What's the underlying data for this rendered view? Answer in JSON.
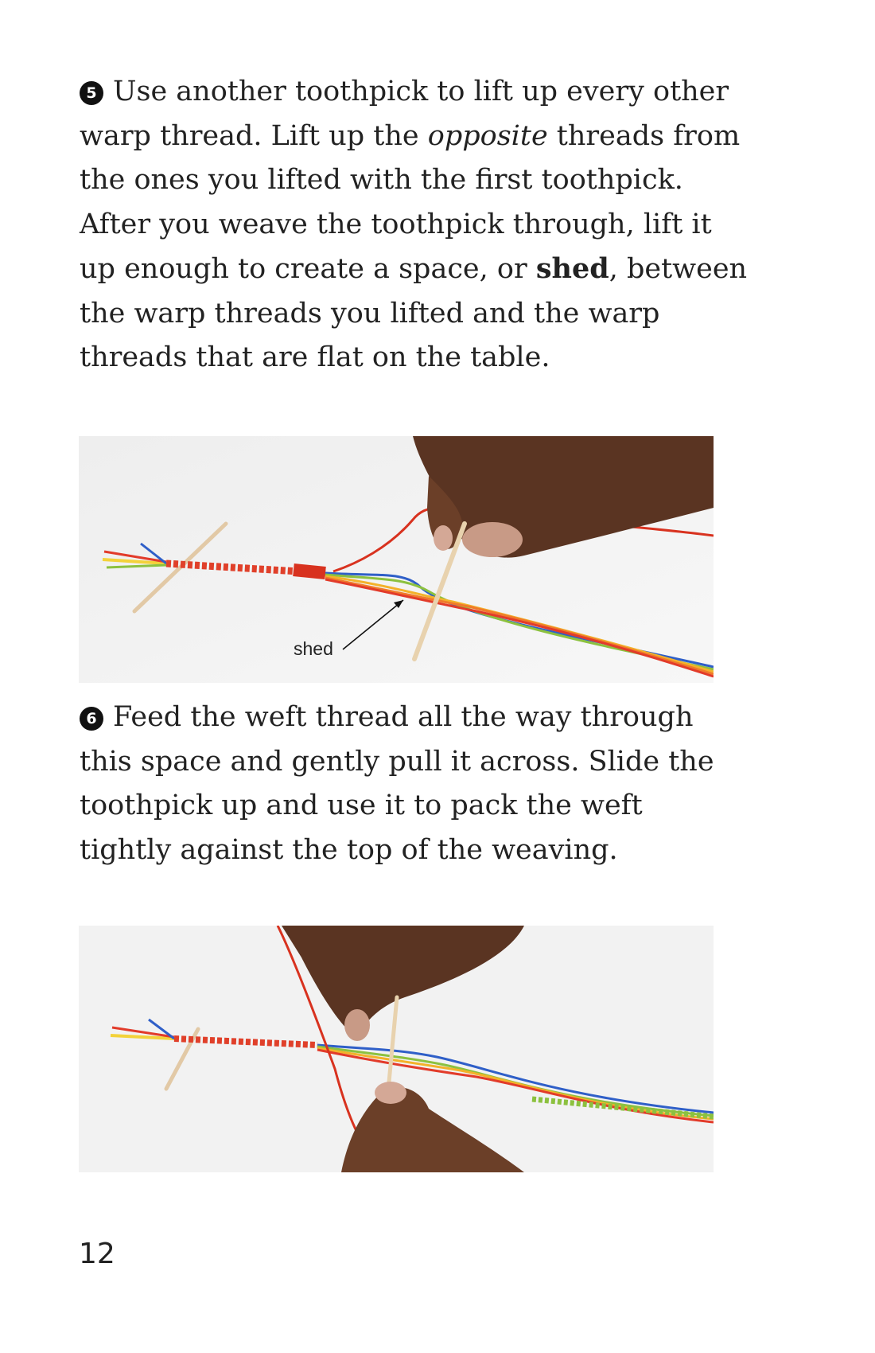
{
  "step5": {
    "number": "5",
    "lines": [
      [
        "Use another toothpick to lift up every other"
      ],
      [
        "warp thread. Lift up the ",
        "opposite",
        " threads from"
      ],
      [
        "the ones you lifted with the first toothpick."
      ],
      [
        "After you weave the toothpick through, lift it"
      ],
      [
        "up enough to create a space, or ",
        "shed",
        ", between"
      ],
      [
        "the warp threads you lifted and the warp"
      ],
      [
        "threads that are flat on the table."
      ]
    ]
  },
  "photo1": {
    "label": "shed"
  },
  "step6": {
    "number": "6",
    "lines": [
      "Feed the weft thread all the way through",
      "this space and gently pull it across. Slide the",
      "toothpick up and use it to pack the weft",
      "tightly against the top of the weaving."
    ]
  },
  "page_number": "12"
}
